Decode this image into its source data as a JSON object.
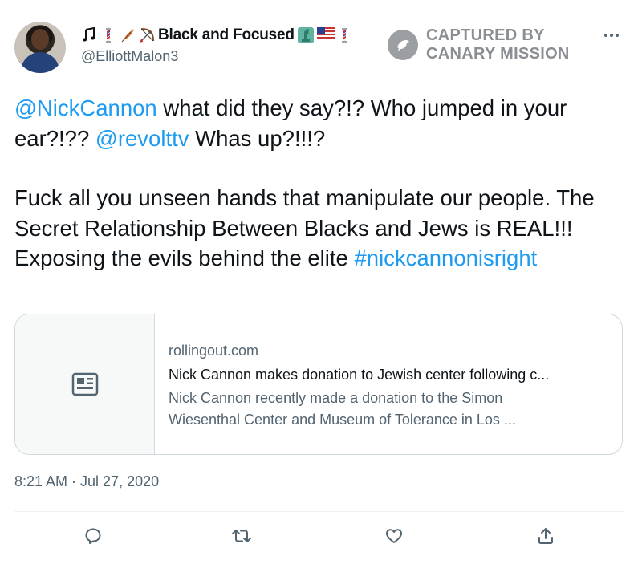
{
  "author": {
    "display_name": "Black and Focused",
    "handle": "@ElliottMalon3",
    "name_emojis": [
      "music-notes-icon",
      "barber-pole-icon",
      "feather-icon",
      "bow-and-arrow-icon",
      "statue-of-liberty-icon",
      "us-flag-icon",
      "barber-pole-icon"
    ]
  },
  "watermark": {
    "line1": "CAPTURED BY",
    "line2": "CANARY MISSION"
  },
  "tweet": {
    "mention1": "@NickCannon",
    "text1": " what did they say?!? Who jumped in your ear?!?? ",
    "mention2": "@revolttv",
    "text2": " Whas up?!!!?",
    "text3": "Fuck all you unseen hands that manipulate our people. The Secret Relationship Between Blacks and Jews is REAL!!! Exposing the evils behind the elite ",
    "hashtag": "#nickcannonisright"
  },
  "card": {
    "domain": "rollingout.com",
    "title": "Nick Cannon makes donation to Jewish center following c...",
    "description": "Nick Cannon recently made a donation to the Simon Wiesenthal Center and Museum of Tolerance in Los ..."
  },
  "timestamp": "8:21 AM · Jul 27, 2020",
  "colors": {
    "link": "#1d9bf0",
    "secondary_text": "#536471",
    "border": "#cfd9de"
  }
}
